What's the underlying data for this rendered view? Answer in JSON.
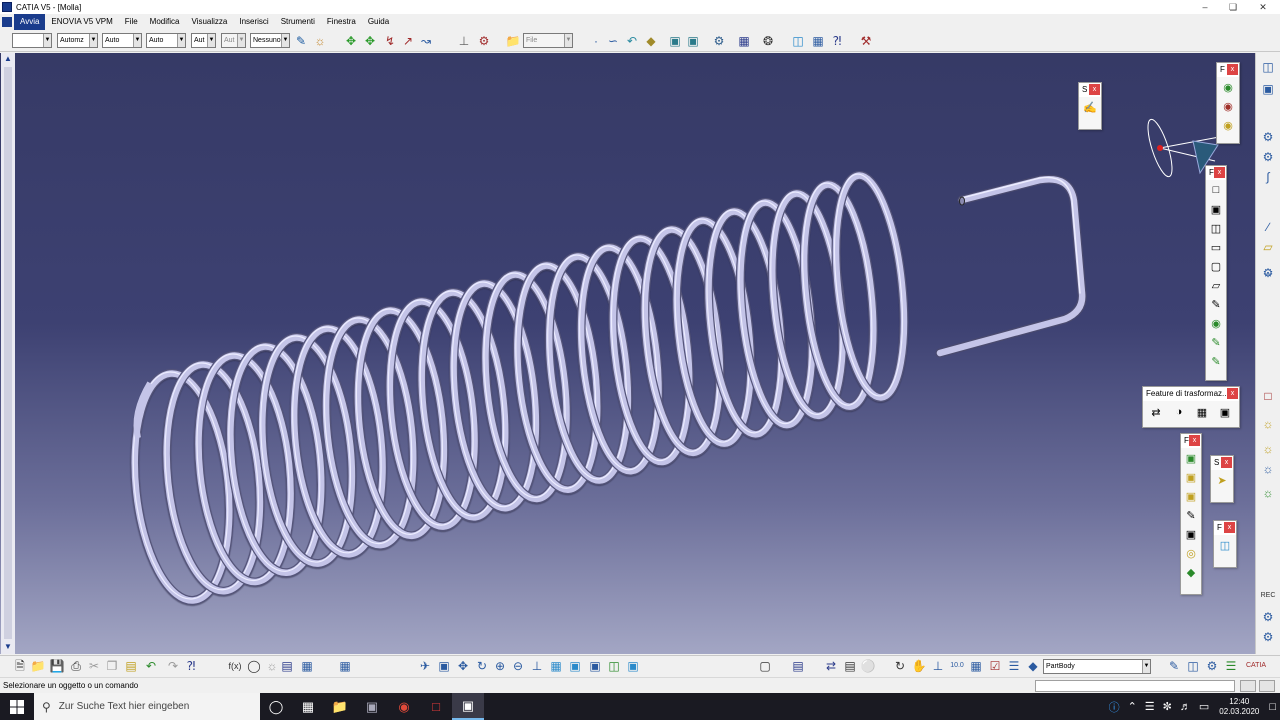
{
  "window": {
    "title": "CATIA V5 - [Molla]"
  },
  "menu": {
    "items": [
      {
        "label": "Avvia",
        "active": true
      },
      {
        "label": "ENOVIA V5 VPM"
      },
      {
        "label": "File"
      },
      {
        "label": "Modifica"
      },
      {
        "label": "Visualizza"
      },
      {
        "label": "Inserisci"
      },
      {
        "label": "Strumenti"
      },
      {
        "label": "Finestra"
      },
      {
        "label": "Guida"
      }
    ]
  },
  "top_toolbar": {
    "combos": [
      {
        "value": ""
      },
      {
        "value": "Automz"
      },
      {
        "value": "Auto"
      },
      {
        "value": "Auto"
      },
      {
        "value": "Aut"
      },
      {
        "value": "Aut"
      },
      {
        "value": "Nessuno"
      },
      {
        "value": "File"
      }
    ]
  },
  "floating_panels": {
    "sketcher": {
      "label": "S"
    },
    "features_top": {
      "label": "F"
    },
    "features_mid": {
      "label": "F"
    },
    "transform": {
      "label": "Feature di trasformaz..."
    },
    "features_low": {
      "label": "F"
    },
    "select": {
      "label": "S"
    },
    "surface": {
      "label": "F"
    }
  },
  "bottom_toolbar": {
    "body_select": "PartBody"
  },
  "status": {
    "message": "Selezionare un oggetto o un comando"
  },
  "taskbar": {
    "search_placeholder": "Zur Suche Text hier eingeben",
    "time": "12:40",
    "date": "02.03.2020"
  },
  "colors": {
    "viewport_top": "#363a66",
    "viewport_bottom": "#a3a6c4",
    "spring": "#c4c4e8",
    "accent": "#1a3c8c"
  }
}
